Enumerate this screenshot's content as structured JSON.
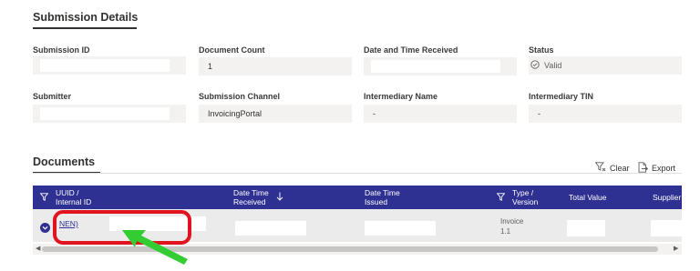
{
  "submission_details": {
    "title": "Submission Details",
    "fields": {
      "submission_id": {
        "label": "Submission ID",
        "value": ""
      },
      "document_count": {
        "label": "Document Count",
        "value": "1"
      },
      "date_time_received": {
        "label": "Date and Time Received",
        "value": ""
      },
      "status": {
        "label": "Status",
        "value": "Valid",
        "icon": "check-circle-icon"
      },
      "submitter": {
        "label": "Submitter",
        "value": ""
      },
      "submission_channel": {
        "label": "Submission Channel",
        "value": "InvoicingPortal"
      },
      "intermediary_name": {
        "label": "Intermediary Name",
        "value": "-"
      },
      "intermediary_tin": {
        "label": "Intermediary TIN",
        "value": "-"
      }
    }
  },
  "documents": {
    "title": "Documents",
    "toolbar": {
      "clear_label": "Clear",
      "export_label": "Export"
    },
    "header_color": "#2e3192",
    "columns": {
      "uuid": {
        "line1": "UUID /",
        "line2": "Internal ID"
      },
      "date_received": {
        "line1": "Date Time",
        "line2": "Received"
      },
      "date_issued": {
        "line1": "Date Time",
        "line2": "Issued"
      },
      "type_version": {
        "line1": "Type /",
        "line2": "Version"
      },
      "total_value": {
        "line1": "Total Value"
      },
      "supplier": {
        "line1": "Supplier"
      }
    },
    "row": {
      "uuid_link": "NEN)",
      "type": "Invoice",
      "version": "1.1"
    }
  },
  "annotation": {
    "highlight_color": "#e0131f",
    "arrow_color": "#33cc33"
  }
}
